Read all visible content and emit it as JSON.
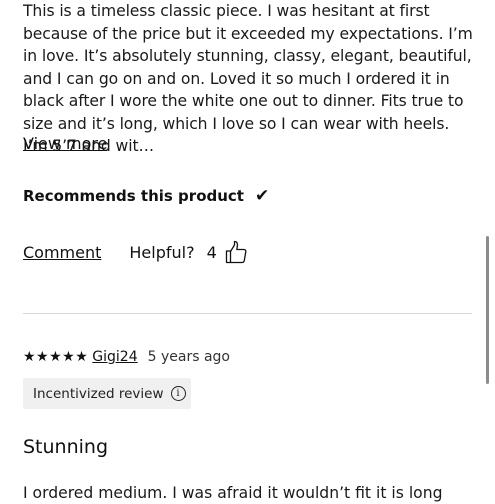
{
  "review1": {
    "body": "This is a timeless classic piece. I was hesitant at first because of the price but it exceeded my expectations. I’m in love. It’s absolutely stunning, classy, elegant, beautiful, and I can go on and on. Loved it so much I ordered it in black after I wore the white one out to dinner. Fits true to size and it’s long, which I love so I can wear with heels. I’m 5’7 and wit…",
    "view_more": "View more",
    "recommends": "Recommends this product",
    "check_icon": "✔",
    "comment": "Comment",
    "helpful_label": "Helpful?",
    "helpful_count": "4"
  },
  "review2": {
    "stars": "★★★★★",
    "rating": 5,
    "author": "Gigi24",
    "time": "5 years ago",
    "badge": "Incentivized review",
    "info_icon": "i",
    "title": "Stunning",
    "body_partial": "I ordered medium. I was afraid it wouldn’t fit it is long"
  },
  "icons": {
    "thumbs_up": "thumbs-up-icon",
    "info": "info-icon",
    "check": "check-icon"
  },
  "colors": {
    "text": "#111111",
    "badge_bg": "#f0f0f0",
    "divider": "#d8d8d8"
  }
}
